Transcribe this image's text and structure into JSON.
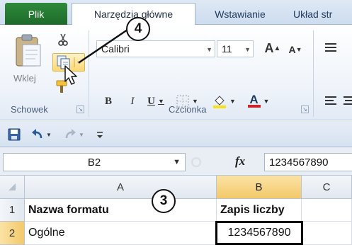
{
  "tabs": {
    "file": "Plik",
    "home": "Narzędzia główne",
    "insert": "Wstawianie",
    "layout": "Układ str"
  },
  "ribbon": {
    "clipboard": {
      "paste_label": "Wklej",
      "group_label": "Schowek",
      "icons": [
        "paste-icon",
        "cut-icon",
        "copy-icon",
        "format-painter-icon"
      ]
    },
    "font": {
      "font_name": "Calibri",
      "font_size": "11",
      "grow_label": "A",
      "shrink_label": "A",
      "bold_label": "B",
      "italic_label": "I",
      "underline_label": "U",
      "font_color_label": "A",
      "group_label": "Czcionka",
      "colors": {
        "highlight": "#f6e21a",
        "font_color": "#d0242b"
      }
    }
  },
  "qat": {
    "icons": [
      "save-icon",
      "undo-icon",
      "redo-icon",
      "customize-qat-icon"
    ]
  },
  "formula_bar": {
    "name_box": "B2",
    "fx_label": "fx",
    "value": "1234567890"
  },
  "sheet": {
    "columns": [
      "A",
      "B",
      "C"
    ],
    "rows": [
      {
        "num": "1",
        "a": "Nazwa formatu",
        "b": "Zapis liczby"
      },
      {
        "num": "2",
        "a": "Ogólne",
        "b": "1234567890"
      }
    ]
  },
  "callouts": {
    "copy_step": "4",
    "cell_step": "3"
  }
}
